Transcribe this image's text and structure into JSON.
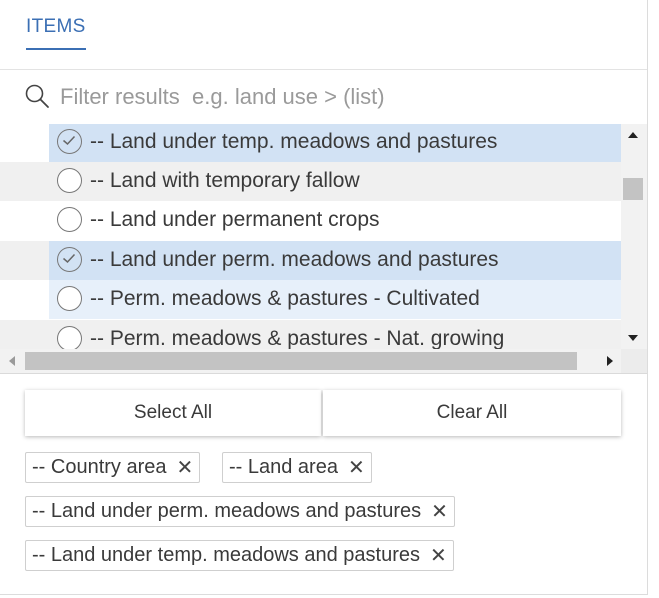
{
  "tabs": {
    "items_label": "ITEMS"
  },
  "search": {
    "placeholder": "Filter results  e.g. land use > (list)",
    "value": ""
  },
  "list": {
    "rows": [
      {
        "label": "-- Land under temp. meadows and pastures",
        "state": "selected"
      },
      {
        "label": "-- Land with temporary fallow",
        "state": "normal"
      },
      {
        "label": "-- Land under permanent crops",
        "state": "normal"
      },
      {
        "label": "-- Land under perm. meadows and pastures",
        "state": "selected"
      },
      {
        "label": "-- Perm. meadows & pastures - Cultivated",
        "state": "hover"
      },
      {
        "label": "-- Perm. meadows & pastures - Nat. growing",
        "state": "normal"
      }
    ]
  },
  "buttons": {
    "select_all": "Select All",
    "clear_all": "Clear All"
  },
  "chips": [
    {
      "label": "-- Country area",
      "remove": "✕"
    },
    {
      "label": "-- Land area",
      "remove": "✕"
    },
    {
      "label": "-- Land under perm. meadows and pastures",
      "remove": "✕"
    },
    {
      "label": "-- Land under temp. meadows and pastures",
      "remove": "✕"
    }
  ],
  "colors": {
    "accent": "#3b6fb4",
    "selected_row": "#d2e2f4",
    "hover_row": "#e7f0fa"
  },
  "icons": {
    "search": "search-icon",
    "check": "check-circle-icon",
    "remove": "close-icon"
  }
}
